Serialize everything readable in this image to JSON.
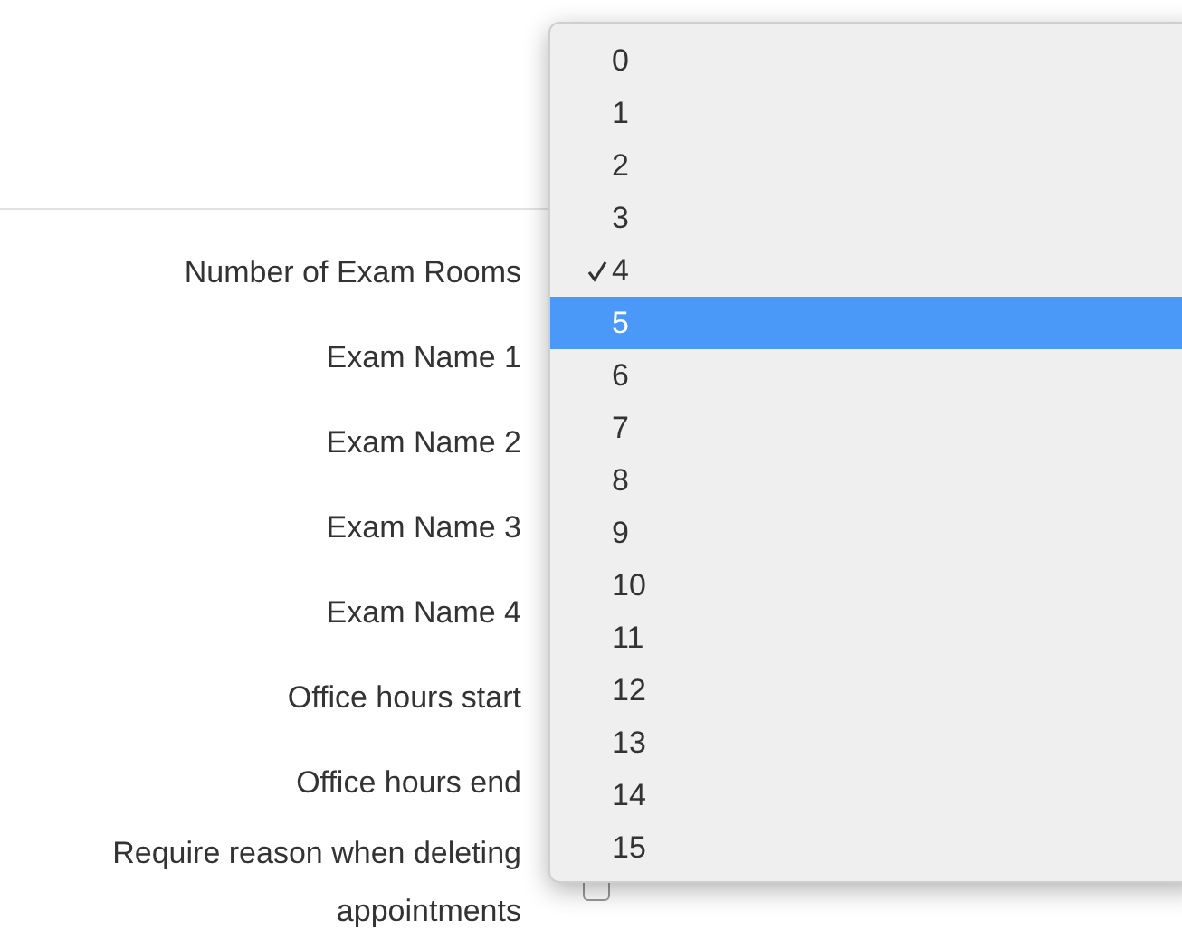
{
  "form": {
    "rows": [
      {
        "label": "Number of Exam Rooms"
      },
      {
        "label": "Exam Name 1"
      },
      {
        "label": "Exam Name 2"
      },
      {
        "label": "Exam Name 3"
      },
      {
        "label": "Exam Name 4"
      },
      {
        "label": "Office hours start"
      },
      {
        "label": "Office hours end"
      },
      {
        "label": "Require reason when deleting appointments",
        "kind": "checkbox",
        "checked": false
      }
    ]
  },
  "menu": {
    "items": [
      {
        "label": "0",
        "checked": false,
        "selected": false
      },
      {
        "label": "1",
        "checked": false,
        "selected": false
      },
      {
        "label": "2",
        "checked": false,
        "selected": false
      },
      {
        "label": "3",
        "checked": false,
        "selected": false
      },
      {
        "label": "4",
        "checked": true,
        "selected": false
      },
      {
        "label": "5",
        "checked": false,
        "selected": true
      },
      {
        "label": "6",
        "checked": false,
        "selected": false
      },
      {
        "label": "7",
        "checked": false,
        "selected": false
      },
      {
        "label": "8",
        "checked": false,
        "selected": false
      },
      {
        "label": "9",
        "checked": false,
        "selected": false
      },
      {
        "label": "10",
        "checked": false,
        "selected": false
      },
      {
        "label": "11",
        "checked": false,
        "selected": false
      },
      {
        "label": "12",
        "checked": false,
        "selected": false
      },
      {
        "label": "13",
        "checked": false,
        "selected": false
      },
      {
        "label": "14",
        "checked": false,
        "selected": false
      },
      {
        "label": "15",
        "checked": false,
        "selected": false
      }
    ]
  }
}
